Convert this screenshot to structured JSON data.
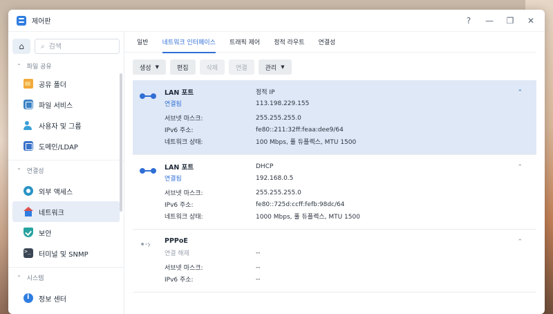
{
  "window": {
    "title": "제어판",
    "controls": [
      "?",
      "—",
      "❐",
      "✕"
    ]
  },
  "sidebar": {
    "search_placeholder": "검색",
    "sections": [
      {
        "label": "파일 공유",
        "items": [
          {
            "label": "공유 폴더",
            "icon": "shared-folder-icon"
          },
          {
            "label": "파일 서비스",
            "icon": "file-services-icon"
          },
          {
            "label": "사용자 및 그룹",
            "icon": "users-groups-icon"
          },
          {
            "label": "도메인/LDAP",
            "icon": "domain-ldap-icon"
          }
        ]
      },
      {
        "label": "연결성",
        "items": [
          {
            "label": "외부 액세스",
            "icon": "external-access-icon"
          },
          {
            "label": "네트워크",
            "icon": "network-icon",
            "active": true
          },
          {
            "label": "보안",
            "icon": "security-icon"
          },
          {
            "label": "터미널 및 SNMP",
            "icon": "terminal-icon"
          }
        ]
      },
      {
        "label": "시스템",
        "items": [
          {
            "label": "정보 센터",
            "icon": "info-center-icon"
          }
        ]
      }
    ]
  },
  "tabs": [
    "일반",
    "네트워크 인터페이스",
    "트래픽 제어",
    "정적 라우트",
    "연결성"
  ],
  "active_tab": "네트워크 인터페이스",
  "toolbar": {
    "create": "생성",
    "edit": "편집",
    "delete": "삭제",
    "connect": "연결",
    "manage": "관리"
  },
  "interfaces": [
    {
      "name": "LAN 포트",
      "status": "연결됨",
      "mode": "정적 IP",
      "ip": "113.198.229.155",
      "subnet_label": "서브넷 마스크:",
      "subnet": "255.255.255.0",
      "ipv6_label": "IPv6 주소:",
      "ipv6": "fe80::211:32ff:feaa:dee9/64",
      "netstate_label": "네트워크 상태:",
      "netstate": "100 Mbps, 풀 듀플렉스, MTU 1500"
    },
    {
      "name": "LAN 포트",
      "status": "연결됨",
      "mode": "DHCP",
      "ip": "192.168.0.5",
      "subnet_label": "서브넷 마스크:",
      "subnet": "255.255.255.0",
      "ipv6_label": "IPv6 주소:",
      "ipv6": "fe80::725d:ccff:fefb:98dc/64",
      "netstate_label": "네트워크 상태:",
      "netstate": "1000 Mbps, 풀 듀플렉스, MTU 1500"
    },
    {
      "name": "PPPoE",
      "status": "연결 해제",
      "mode": "",
      "ip": "--",
      "subnet_label": "서브넷 마스크:",
      "subnet": "--",
      "ipv6_label": "IPv6 주소:",
      "ipv6": "--"
    }
  ],
  "colors": {
    "accent": "#2f6ed5",
    "selected_row": "#dfe8f6",
    "sidebar_active": "#e6edf6"
  }
}
